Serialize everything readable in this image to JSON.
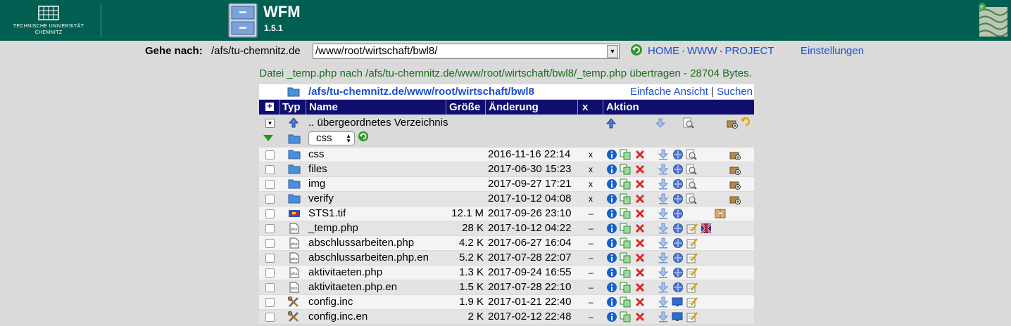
{
  "header": {
    "university_line1": "TECHNISCHE UNIVERSITÄT",
    "university_line2": "CHEMNITZ",
    "app_title": "WFM",
    "app_version": "1.5.1"
  },
  "nav": {
    "goto_label": "Gehe nach:",
    "base_path": "/afs/tu-chemnitz.de",
    "path_value": "/www/root/wirtschaft/bwl8/",
    "links": [
      "HOME",
      "WWW",
      "PROJECT"
    ],
    "settings": "Einstellungen"
  },
  "message": "Datei _temp.php nach /afs/tu-chemnitz.de/www/root/wirtschaft/bwl8/_temp.php übertragen - 28704 Bytes.",
  "breadcrumb": {
    "parts": [
      "/afs/tu-chemnitz.de",
      "/",
      "www",
      "/",
      "root",
      "/",
      "wirtschaft",
      "/",
      "bwl8"
    ],
    "simple_view": "Einfache Ansicht",
    "search": "Suchen"
  },
  "table": {
    "headers": {
      "typ": "Typ",
      "name": "Name",
      "size": "Größe",
      "changed": "Änderung",
      "x": "x",
      "action": "Aktion"
    },
    "parent_label": ".. übergeordnetes Verzeichnis",
    "dir_select_value": "css",
    "rows": [
      {
        "icon": "folder-icon",
        "name": "css",
        "size": "",
        "date": "2016-11-16 22:14",
        "x": "x",
        "kind": "dir"
      },
      {
        "icon": "folder-icon",
        "name": "files",
        "size": "",
        "date": "2017-06-30 15:23",
        "x": "x",
        "kind": "dir"
      },
      {
        "icon": "folder-icon",
        "name": "img",
        "size": "",
        "date": "2017-09-27 17:21",
        "x": "x",
        "kind": "dir"
      },
      {
        "icon": "folder-icon",
        "name": "verify",
        "size": "",
        "date": "2017-10-12 04:08",
        "x": "x",
        "kind": "dir"
      },
      {
        "icon": "image-file-icon",
        "name": "STS1.tif",
        "size": "12.1 M",
        "date": "2017-09-26 23:10",
        "x": "–",
        "kind": "tif"
      },
      {
        "icon": "php-file-icon",
        "name": "_temp.php",
        "size": "28 K",
        "date": "2017-10-12 04:22",
        "x": "–",
        "kind": "php-special"
      },
      {
        "icon": "php-file-icon",
        "name": "abschlussarbeiten.php",
        "size": "4.2 K",
        "date": "2017-06-27 16:04",
        "x": "–",
        "kind": "php"
      },
      {
        "icon": "php-file-icon",
        "name": "abschlussarbeiten.php.en",
        "size": "5.2 K",
        "date": "2017-07-28 22:07",
        "x": "–",
        "kind": "php"
      },
      {
        "icon": "php-file-icon",
        "name": "aktivitaeten.php",
        "size": "1.3 K",
        "date": "2017-09-24 16:55",
        "x": "–",
        "kind": "php"
      },
      {
        "icon": "php-file-icon",
        "name": "aktivitaeten.php.en",
        "size": "1.5 K",
        "date": "2017-07-28 22:10",
        "x": "–",
        "kind": "php"
      },
      {
        "icon": "tools-file-icon",
        "name": "config.inc",
        "size": "1.9 K",
        "date": "2017-01-21 22:40",
        "x": "–",
        "kind": "inc"
      },
      {
        "icon": "tools-file-icon",
        "name": "config.inc.en",
        "size": "2 K",
        "date": "2017-02-12 22:48",
        "x": "–",
        "kind": "inc"
      }
    ]
  },
  "colors": {
    "header_bg": "#005f50",
    "table_header_bg": "#0f0e6e",
    "link": "#1f4fd0",
    "message": "#1c6b1c"
  }
}
